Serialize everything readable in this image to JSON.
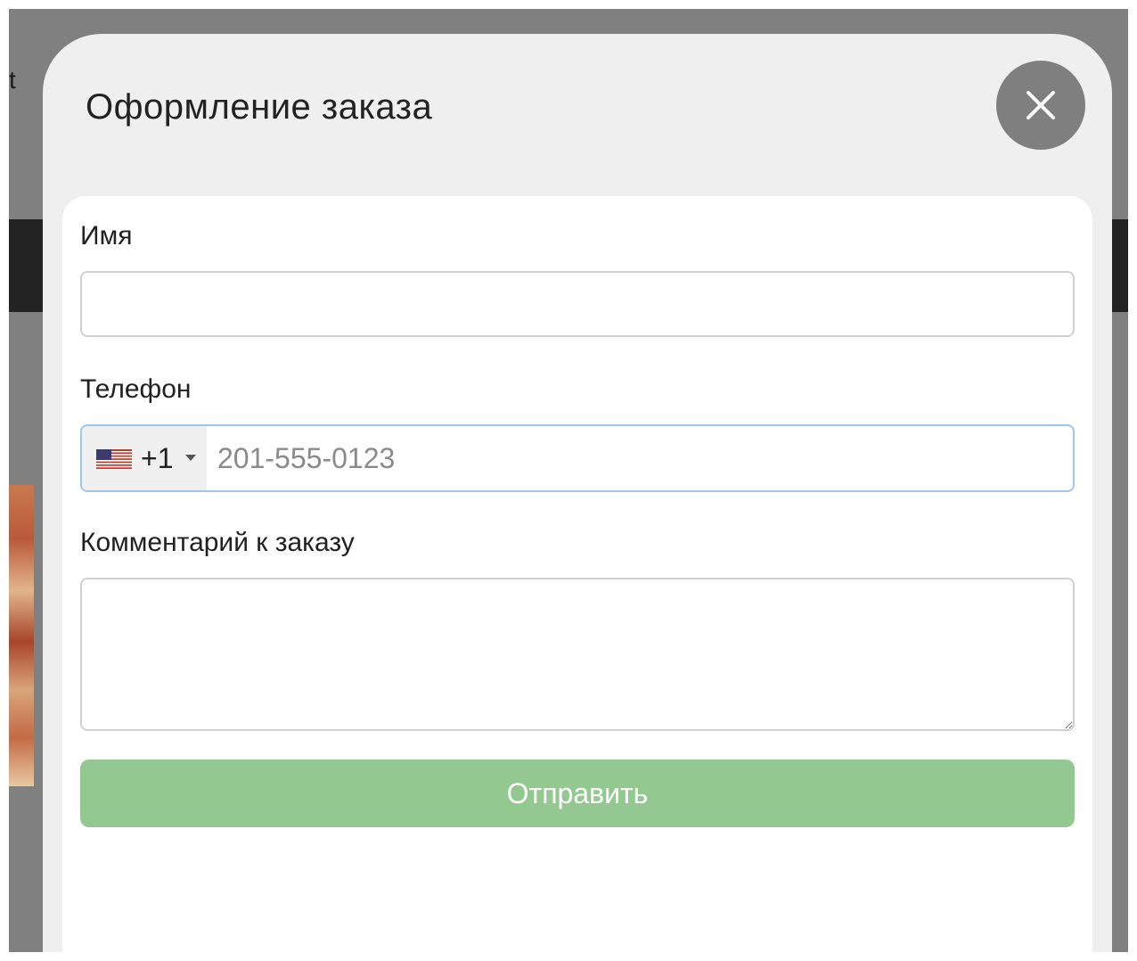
{
  "background": {
    "partial_text": "t"
  },
  "modal": {
    "title": "Оформление заказа",
    "close_icon": "close-icon"
  },
  "form": {
    "name": {
      "label": "Имя",
      "value": ""
    },
    "phone": {
      "label": "Телефон",
      "country_flag": "us-flag-icon",
      "dial_code": "+1",
      "placeholder": "201-555-0123",
      "value": ""
    },
    "comment": {
      "label": "Комментарий к заказу",
      "value": ""
    },
    "submit_label": "Отправить"
  },
  "colors": {
    "overlay": "#808080",
    "modal_bg": "#efefef",
    "close_button": "#7f7f7f",
    "submit_button": "#93c890",
    "focus_border": "#9ec4f2"
  }
}
